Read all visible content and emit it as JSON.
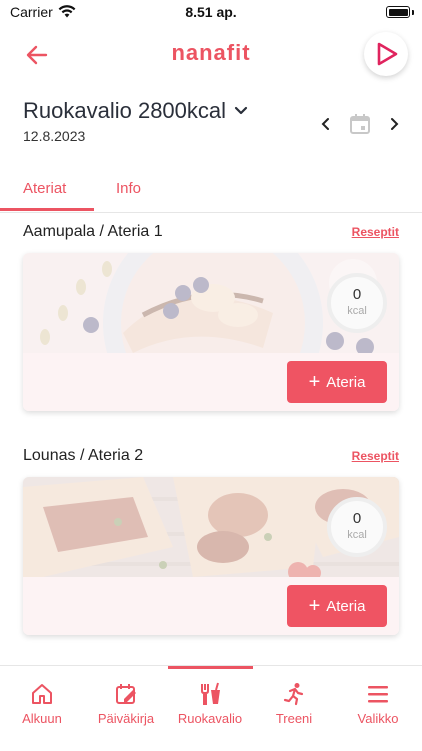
{
  "status_bar": {
    "carrier": "Carrier",
    "time": "8.51 ap."
  },
  "header": {
    "brand": "nanafit"
  },
  "plan": {
    "title": "Ruokavalio 2800kcal",
    "date": "12.8.2023"
  },
  "tabs": [
    {
      "label": "Ateriat",
      "active": true
    },
    {
      "label": "Info",
      "active": false
    }
  ],
  "meals": [
    {
      "title": "Aamupala / Ateria 1",
      "recipes_link": "Reseptit",
      "kcal_value": "0",
      "kcal_unit": "kcal",
      "add_label": "Ateria"
    },
    {
      "title": "Lounas / Ateria 2",
      "recipes_link": "Reseptit",
      "kcal_value": "0",
      "kcal_unit": "kcal",
      "add_label": "Ateria"
    }
  ],
  "bottom_nav": [
    {
      "label": "Alkuun",
      "icon": "home-icon"
    },
    {
      "label": "Päiväkirja",
      "icon": "diary-icon"
    },
    {
      "label": "Ruokavalio",
      "icon": "cutlery-icon",
      "active": true
    },
    {
      "label": "Treeni",
      "icon": "running-icon"
    },
    {
      "label": "Valikko",
      "icon": "menu-icon"
    }
  ],
  "colors": {
    "accent": "#ec5462",
    "button": "#ef5463"
  }
}
